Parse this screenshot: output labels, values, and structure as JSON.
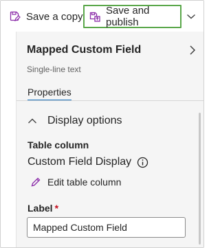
{
  "toolbar": {
    "save_copy_label": "Save a copy",
    "save_publish_label": "Save and publish",
    "save_copy_icon": "save-copy-icon",
    "save_publish_icon": "save-publish-icon",
    "overflow_icon": "chevron-down-icon",
    "highlight_color": "#5aa74a"
  },
  "panel": {
    "field_name": "Mapped Custom Field",
    "field_type": "Single-line text",
    "tab_label": "Properties",
    "tab_indicator_color": "#0f6cbd",
    "section": {
      "title": "Display options",
      "expanded": true,
      "table_column_label": "Table column",
      "display_name": "Custom Field Display",
      "edit_link": "Edit table column",
      "label_caption": "Label",
      "required_marker": "*",
      "label_value": "Mapped Custom Field"
    }
  }
}
